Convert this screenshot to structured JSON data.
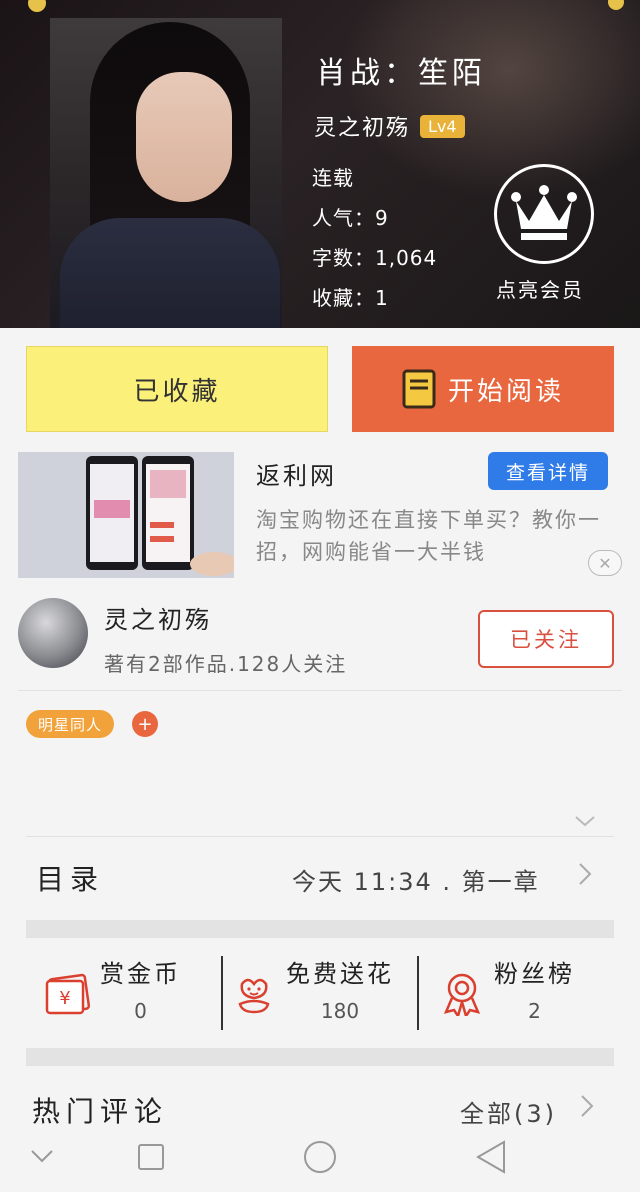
{
  "book": {
    "title": "肖战：笙陌",
    "author": "灵之初殇",
    "level": "Lv4",
    "status": "连载",
    "popularity": "人气：9",
    "word_count": "字数：1,064",
    "favorites": "收藏：1"
  },
  "vip": {
    "label": "点亮会员",
    "icon": "crown-icon"
  },
  "actions": {
    "favorited_label": "已收藏",
    "read_label": "开始阅读",
    "read_icon": "book-icon"
  },
  "ad": {
    "title": "返利网",
    "button": "查看详情",
    "description": "淘宝购物还在直接下单买？教你一招，网购能省一大半钱",
    "close": "✕"
  },
  "author": {
    "name": "灵之初殇",
    "stats": "著有2部作品.128人关注",
    "follow_label": "已关注"
  },
  "tags": {
    "items": [
      "明星同人"
    ],
    "add": "+"
  },
  "catalog": {
    "label": "目录",
    "latest": "今天 11:34 . 第一章"
  },
  "rewards": [
    {
      "label": "赏金币",
      "value": "0",
      "icon": "red-envelope-icon"
    },
    {
      "label": "免费送花",
      "value": "180",
      "icon": "flower-icon"
    },
    {
      "label": "粉丝榜",
      "value": "2",
      "icon": "medal-icon"
    }
  ],
  "comments": {
    "label": "热门评论",
    "all": "全部(3)"
  },
  "colors": {
    "accent_orange": "#e9673f",
    "favorite_yellow": "#fbf07a",
    "ad_blue": "#2f7ce8",
    "level_gold": "#e8b338",
    "follow_red": "#d9503f"
  }
}
